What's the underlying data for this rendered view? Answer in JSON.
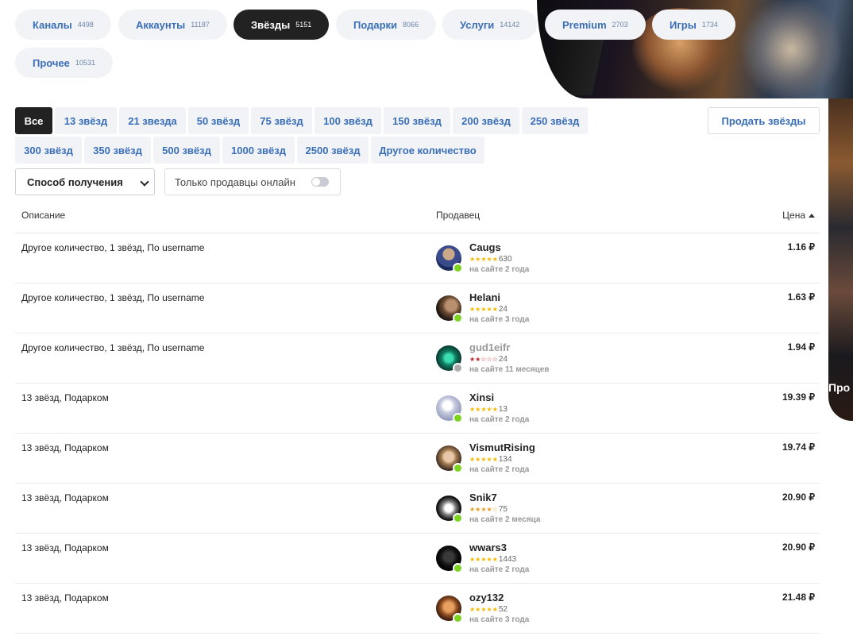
{
  "categories": [
    {
      "label": "Каналы",
      "count": "4498",
      "active": false
    },
    {
      "label": "Аккаунты",
      "count": "11187",
      "active": false
    },
    {
      "label": "Звёзды",
      "count": "5151",
      "active": true
    },
    {
      "label": "Подарки",
      "count": "8066",
      "active": false
    },
    {
      "label": "Услуги",
      "count": "14142",
      "active": false
    },
    {
      "label": "Premium",
      "count": "2703",
      "active": false
    },
    {
      "label": "Игры",
      "count": "1734",
      "active": false
    },
    {
      "label": "Прочее",
      "count": "10531",
      "active": false
    }
  ],
  "filters": [
    "Все",
    "13 звёзд",
    "21 звезда",
    "50 звёзд",
    "75 звёзд",
    "100 звёзд",
    "150 звёзд",
    "200 звёзд",
    "250 звёзд",
    "300 звёзд",
    "350 звёзд",
    "500 звёзд",
    "1000 звёзд",
    "2500 звёзд",
    "Другое количество"
  ],
  "sell_button": "Продать звёзды",
  "method_select": {
    "value": "Способ получения"
  },
  "online_toggle": {
    "label": "Только продавцы онлайн",
    "on": false
  },
  "table": {
    "headers": {
      "description": "Описание",
      "seller": "Продавец",
      "price": "Цена"
    },
    "rows": [
      {
        "description": "Другое количество, 1 звёзд, По username",
        "seller": "Caugs",
        "stars": "★★★★★",
        "reviews": "630",
        "since": "на сайте 2 года",
        "price": "1.16 ₽",
        "online": true
      },
      {
        "description": "Другое количество, 1 звёзд, По username",
        "seller": "Helani",
        "stars": "★★★★★",
        "reviews": "24",
        "since": "на сайте 3 года",
        "price": "1.63 ₽",
        "online": true
      },
      {
        "description": "Другое количество, 1 звёзд, По username",
        "seller": "gud1eifr",
        "stars": "★★☆☆☆",
        "reviews": "24",
        "since": "на сайте 11 месяцев",
        "price": "1.94 ₽",
        "online": false
      },
      {
        "description": "13 звёзд, Подарком",
        "seller": "Xinsi",
        "stars": "★★★★★",
        "reviews": "13",
        "since": "на сайте 2 года",
        "price": "19.39 ₽",
        "online": true
      },
      {
        "description": "13 звёзд, Подарком",
        "seller": "VismutRising",
        "stars": "★★★★★",
        "reviews": "134",
        "since": "на сайте 2 года",
        "price": "19.74 ₽",
        "online": true
      },
      {
        "description": "13 звёзд, Подарком",
        "seller": "Snik7",
        "stars": "★★★★☆",
        "reviews": "75",
        "since": "на сайте 2 месяца",
        "price": "20.90 ₽",
        "online": true
      },
      {
        "description": "13 звёзд, Подарком",
        "seller": "wwars3",
        "stars": "★★★★★",
        "reviews": "1443",
        "since": "на сайте 2 года",
        "price": "20.90 ₽",
        "online": true
      },
      {
        "description": "13 звёзд, Подарком",
        "seller": "ozy132",
        "stars": "★★★★★",
        "reviews": "52",
        "since": "на сайте 3 года",
        "price": "21.48 ₽",
        "online": true
      }
    ]
  },
  "banner": {
    "promo_text": "Про"
  },
  "colors": {
    "accent": "#3a6fb8",
    "online": "#7ed321",
    "offline": "#aaaaaa",
    "active_bg": "#222222"
  }
}
